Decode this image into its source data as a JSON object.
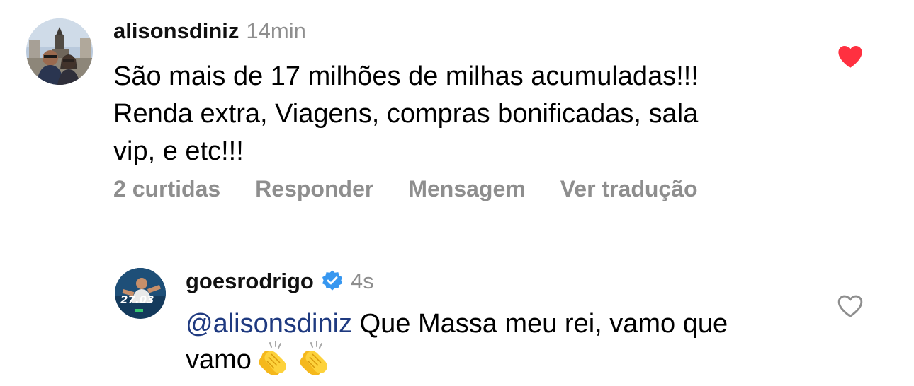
{
  "comment1": {
    "username": "alisonsdiniz",
    "time": "14min",
    "text_line1": "São mais de 17 milhões de milhas acumuladas!!!",
    "text_line2": "Renda extra, Viagens, compras bonificadas, sala",
    "text_line3": "vip, e etc!!!",
    "liked": true,
    "actions": {
      "likes": "2 curtidas",
      "reply": "Responder",
      "message": "Mensagem",
      "translate": "Ver tradução"
    }
  },
  "reply": {
    "username": "goesrodrigo",
    "verified": true,
    "time": "4s",
    "avatar_badge": "27.03",
    "mention": "@alisonsdiniz",
    "text_line1": " Que Massa meu rei, vamo que",
    "text_line2": "vamo",
    "emojis": [
      "clapping-hands-emoji",
      "clapping-hands-emoji"
    ],
    "liked": false
  },
  "colors": {
    "like_red": "#ff3040",
    "muted": "#8e8e8e",
    "mention": "#1f3a80",
    "verified_blue": "#3797f0"
  }
}
